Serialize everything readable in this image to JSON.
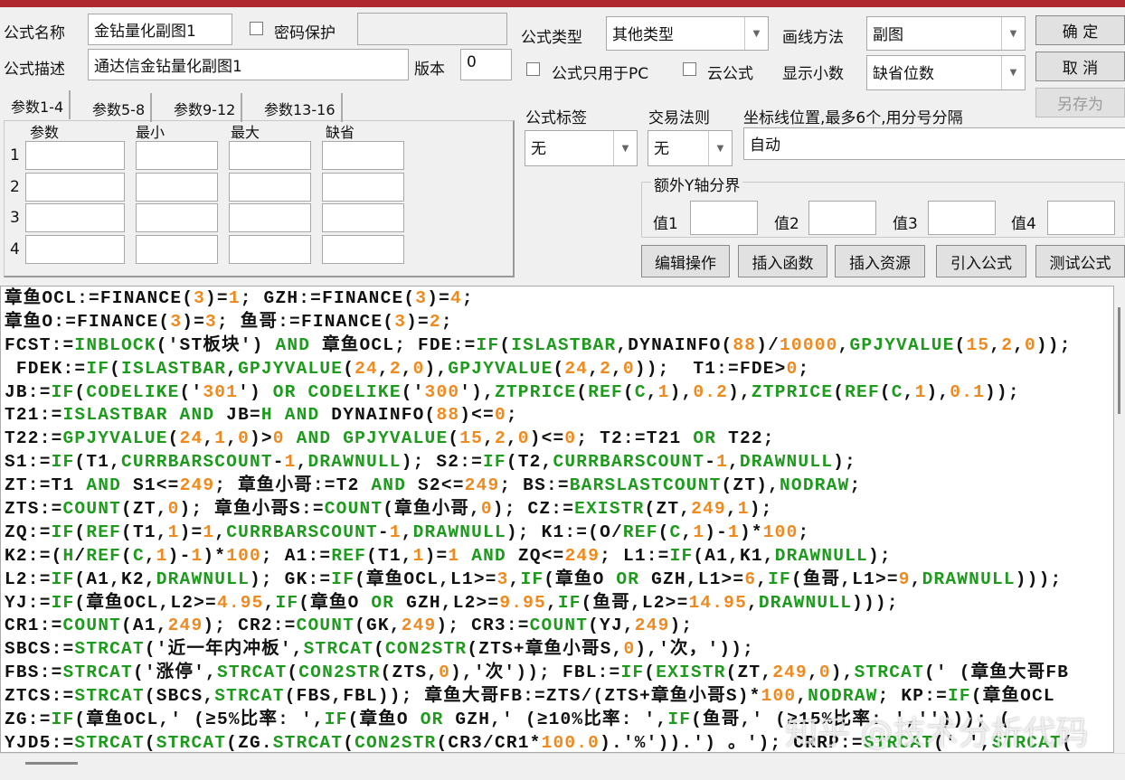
{
  "form": {
    "name_label": "公式名称",
    "name_value": "金钻量化副图1",
    "password_label": "密码保护",
    "desc_label": "公式描述",
    "desc_value": "通达信金钻量化副图1",
    "version_label": "版本",
    "version_value": "0",
    "type_label": "公式类型",
    "type_value": "其他类型",
    "draw_label": "画线方法",
    "draw_value": "副图",
    "pc_only_label": "公式只用于PC",
    "cloud_label": "云公式",
    "decimals_label": "显示小数",
    "decimals_value": "缺省位数",
    "tag_label": "公式标签",
    "tag_value": "无",
    "trade_label": "交易法则",
    "trade_value": "无",
    "axis_label": "坐标线位置,最多6个,用分号分隔",
    "axis_value": "自动",
    "extra_y_label": "额外Y轴分界",
    "values": [
      "值1",
      "值2",
      "值3",
      "值4"
    ]
  },
  "buttons": {
    "ok": "确 定",
    "cancel": "取 消",
    "save_as": "另存为",
    "edit": "编辑操作",
    "insert_func": "插入函数",
    "insert_res": "插入资源",
    "import": "引入公式",
    "test": "测试公式"
  },
  "params": {
    "tabs": [
      "参数1-4",
      "参数5-8",
      "参数9-12",
      "参数13-16"
    ],
    "headers": [
      "参数",
      "最小",
      "最大",
      "缺省"
    ],
    "rows": [
      "1",
      "2",
      "3",
      "4"
    ]
  },
  "watermark": "知乎 @技术分析代码",
  "code_lines": [
    [
      [
        "t",
        "章鱼OCL:=FINANCE("
      ],
      [
        "n",
        "3"
      ],
      [
        "t",
        ")="
      ],
      [
        "n",
        "1"
      ],
      [
        "t",
        "; GZH:=FINANCE("
      ],
      [
        "n",
        "3"
      ],
      [
        "t",
        ")="
      ],
      [
        "n",
        "4"
      ],
      [
        "t",
        ";"
      ]
    ],
    [
      [
        "t",
        "章鱼O:=FINANCE("
      ],
      [
        "n",
        "3"
      ],
      [
        "t",
        ")="
      ],
      [
        "n",
        "3"
      ],
      [
        "t",
        "; 鱼哥:=FINANCE("
      ],
      [
        "n",
        "3"
      ],
      [
        "t",
        ")="
      ],
      [
        "n",
        "2"
      ],
      [
        "t",
        ";"
      ]
    ],
    [
      [
        "t",
        "FCST:="
      ],
      [
        "f",
        "INBLOCK"
      ],
      [
        "t",
        "('ST板块') "
      ],
      [
        "f",
        "AND"
      ],
      [
        "t",
        " 章鱼OCL; FDE:="
      ],
      [
        "f",
        "IF"
      ],
      [
        "t",
        "("
      ],
      [
        "f",
        "ISLASTBAR"
      ],
      [
        "t",
        ",DYNAINFO("
      ],
      [
        "n",
        "88"
      ],
      [
        "t",
        ")/"
      ],
      [
        "n",
        "10000"
      ],
      [
        "t",
        ","
      ],
      [
        "f",
        "GPJYVALUE"
      ],
      [
        "t",
        "("
      ],
      [
        "n",
        "15"
      ],
      [
        "t",
        ","
      ],
      [
        "n",
        "2"
      ],
      [
        "t",
        ","
      ],
      [
        "n",
        "0"
      ],
      [
        "t",
        "));"
      ]
    ],
    [
      [
        "t",
        " FDEK:="
      ],
      [
        "f",
        "IF"
      ],
      [
        "t",
        "("
      ],
      [
        "f",
        "ISLASTBAR"
      ],
      [
        "t",
        ","
      ],
      [
        "f",
        "GPJYVALUE"
      ],
      [
        "t",
        "("
      ],
      [
        "n",
        "24"
      ],
      [
        "t",
        ","
      ],
      [
        "n",
        "2"
      ],
      [
        "t",
        ","
      ],
      [
        "n",
        "0"
      ],
      [
        "t",
        "),"
      ],
      [
        "f",
        "GPJYVALUE"
      ],
      [
        "t",
        "("
      ],
      [
        "n",
        "24"
      ],
      [
        "t",
        ","
      ],
      [
        "n",
        "2"
      ],
      [
        "t",
        ","
      ],
      [
        "n",
        "0"
      ],
      [
        "t",
        "));  T1:=FDE>"
      ],
      [
        "n",
        "0"
      ],
      [
        "t",
        ";"
      ]
    ],
    [
      [
        "t",
        "JB:="
      ],
      [
        "f",
        "IF"
      ],
      [
        "t",
        "("
      ],
      [
        "f",
        "CODELIKE"
      ],
      [
        "t",
        "('"
      ],
      [
        "n",
        "301"
      ],
      [
        "t",
        "') "
      ],
      [
        "f",
        "OR"
      ],
      [
        "t",
        " "
      ],
      [
        "f",
        "CODELIKE"
      ],
      [
        "t",
        "('"
      ],
      [
        "n",
        "300"
      ],
      [
        "t",
        "'),"
      ],
      [
        "f",
        "ZTPRICE"
      ],
      [
        "t",
        "("
      ],
      [
        "f",
        "REF"
      ],
      [
        "t",
        "("
      ],
      [
        "f",
        "C"
      ],
      [
        "t",
        ","
      ],
      [
        "n",
        "1"
      ],
      [
        "t",
        "),"
      ],
      [
        "n",
        "0.2"
      ],
      [
        "t",
        "),"
      ],
      [
        "f",
        "ZTPRICE"
      ],
      [
        "t",
        "("
      ],
      [
        "f",
        "REF"
      ],
      [
        "t",
        "("
      ],
      [
        "f",
        "C"
      ],
      [
        "t",
        ","
      ],
      [
        "n",
        "1"
      ],
      [
        "t",
        "),"
      ],
      [
        "n",
        "0.1"
      ],
      [
        "t",
        "));"
      ]
    ],
    [
      [
        "t",
        "T21:="
      ],
      [
        "f",
        "ISLASTBAR"
      ],
      [
        "t",
        " "
      ],
      [
        "f",
        "AND"
      ],
      [
        "t",
        " JB="
      ],
      [
        "f",
        "H"
      ],
      [
        "t",
        " "
      ],
      [
        "f",
        "AND"
      ],
      [
        "t",
        " DYNAINFO("
      ],
      [
        "n",
        "88"
      ],
      [
        "t",
        ")<="
      ],
      [
        "n",
        "0"
      ],
      [
        "t",
        ";"
      ]
    ],
    [
      [
        "t",
        "T22:="
      ],
      [
        "f",
        "GPJYVALUE"
      ],
      [
        "t",
        "("
      ],
      [
        "n",
        "24"
      ],
      [
        "t",
        ","
      ],
      [
        "n",
        "1"
      ],
      [
        "t",
        ","
      ],
      [
        "n",
        "0"
      ],
      [
        "t",
        ")>"
      ],
      [
        "n",
        "0"
      ],
      [
        "t",
        " "
      ],
      [
        "f",
        "AND"
      ],
      [
        "t",
        " "
      ],
      [
        "f",
        "GPJYVALUE"
      ],
      [
        "t",
        "("
      ],
      [
        "n",
        "15"
      ],
      [
        "t",
        ","
      ],
      [
        "n",
        "2"
      ],
      [
        "t",
        ","
      ],
      [
        "n",
        "0"
      ],
      [
        "t",
        ")<="
      ],
      [
        "n",
        "0"
      ],
      [
        "t",
        "; T2:=T21 "
      ],
      [
        "f",
        "OR"
      ],
      [
        "t",
        " T22;"
      ]
    ],
    [
      [
        "t",
        "S1:="
      ],
      [
        "f",
        "IF"
      ],
      [
        "t",
        "(T1,"
      ],
      [
        "f",
        "CURRBARSCOUNT"
      ],
      [
        "t",
        "-"
      ],
      [
        "n",
        "1"
      ],
      [
        "t",
        ","
      ],
      [
        "f",
        "DRAWNULL"
      ],
      [
        "t",
        "); S2:="
      ],
      [
        "f",
        "IF"
      ],
      [
        "t",
        "(T2,"
      ],
      [
        "f",
        "CURRBARSCOUNT"
      ],
      [
        "t",
        "-"
      ],
      [
        "n",
        "1"
      ],
      [
        "t",
        ","
      ],
      [
        "f",
        "DRAWNULL"
      ],
      [
        "t",
        ");"
      ]
    ],
    [
      [
        "t",
        "ZT:=T1 "
      ],
      [
        "f",
        "AND"
      ],
      [
        "t",
        " S1<="
      ],
      [
        "n",
        "249"
      ],
      [
        "t",
        "; 章鱼小哥:=T2 "
      ],
      [
        "f",
        "AND"
      ],
      [
        "t",
        " S2<="
      ],
      [
        "n",
        "249"
      ],
      [
        "t",
        "; BS:="
      ],
      [
        "f",
        "BARSLASTCOUNT"
      ],
      [
        "t",
        "(ZT),"
      ],
      [
        "f",
        "NODRAW"
      ],
      [
        "t",
        ";"
      ]
    ],
    [
      [
        "t",
        "ZTS:="
      ],
      [
        "f",
        "COUNT"
      ],
      [
        "t",
        "(ZT,"
      ],
      [
        "n",
        "0"
      ],
      [
        "t",
        "); 章鱼小哥S:="
      ],
      [
        "f",
        "COUNT"
      ],
      [
        "t",
        "(章鱼小哥,"
      ],
      [
        "n",
        "0"
      ],
      [
        "t",
        "); CZ:="
      ],
      [
        "f",
        "EXISTR"
      ],
      [
        "t",
        "(ZT,"
      ],
      [
        "n",
        "249"
      ],
      [
        "t",
        ","
      ],
      [
        "n",
        "1"
      ],
      [
        "t",
        ");"
      ]
    ],
    [
      [
        "t",
        "ZQ:="
      ],
      [
        "f",
        "IF"
      ],
      [
        "t",
        "("
      ],
      [
        "f",
        "REF"
      ],
      [
        "t",
        "(T1,"
      ],
      [
        "n",
        "1"
      ],
      [
        "t",
        ")="
      ],
      [
        "n",
        "1"
      ],
      [
        "t",
        ","
      ],
      [
        "f",
        "CURRBARSCOUNT"
      ],
      [
        "t",
        "-"
      ],
      [
        "n",
        "1"
      ],
      [
        "t",
        ","
      ],
      [
        "f",
        "DRAWNULL"
      ],
      [
        "t",
        "); K1:=(O/"
      ],
      [
        "f",
        "REF"
      ],
      [
        "t",
        "("
      ],
      [
        "f",
        "C"
      ],
      [
        "t",
        ","
      ],
      [
        "n",
        "1"
      ],
      [
        "t",
        ")-"
      ],
      [
        "n",
        "1"
      ],
      [
        "t",
        ")*"
      ],
      [
        "n",
        "100"
      ],
      [
        "t",
        ";"
      ]
    ],
    [
      [
        "t",
        "K2:=("
      ],
      [
        "f",
        "H"
      ],
      [
        "t",
        "/"
      ],
      [
        "f",
        "REF"
      ],
      [
        "t",
        "("
      ],
      [
        "f",
        "C"
      ],
      [
        "t",
        ","
      ],
      [
        "n",
        "1"
      ],
      [
        "t",
        ")-"
      ],
      [
        "n",
        "1"
      ],
      [
        "t",
        ")*"
      ],
      [
        "n",
        "100"
      ],
      [
        "t",
        "; A1:="
      ],
      [
        "f",
        "REF"
      ],
      [
        "t",
        "(T1,"
      ],
      [
        "n",
        "1"
      ],
      [
        "t",
        ")="
      ],
      [
        "n",
        "1"
      ],
      [
        "t",
        " "
      ],
      [
        "f",
        "AND"
      ],
      [
        "t",
        " ZQ<="
      ],
      [
        "n",
        "249"
      ],
      [
        "t",
        "; L1:="
      ],
      [
        "f",
        "IF"
      ],
      [
        "t",
        "(A1,K1,"
      ],
      [
        "f",
        "DRAWNULL"
      ],
      [
        "t",
        ");"
      ]
    ],
    [
      [
        "t",
        "L2:="
      ],
      [
        "f",
        "IF"
      ],
      [
        "t",
        "(A1,K2,"
      ],
      [
        "f",
        "DRAWNULL"
      ],
      [
        "t",
        "); GK:="
      ],
      [
        "f",
        "IF"
      ],
      [
        "t",
        "(章鱼OCL,L1>="
      ],
      [
        "n",
        "3"
      ],
      [
        "t",
        ","
      ],
      [
        "f",
        "IF"
      ],
      [
        "t",
        "(章鱼O "
      ],
      [
        "f",
        "OR"
      ],
      [
        "t",
        " GZH,L1>="
      ],
      [
        "n",
        "6"
      ],
      [
        "t",
        ","
      ],
      [
        "f",
        "IF"
      ],
      [
        "t",
        "(鱼哥,L1>="
      ],
      [
        "n",
        "9"
      ],
      [
        "t",
        ","
      ],
      [
        "f",
        "DRAWNULL"
      ],
      [
        "t",
        ")));"
      ]
    ],
    [
      [
        "t",
        "YJ:="
      ],
      [
        "f",
        "IF"
      ],
      [
        "t",
        "(章鱼OCL,L2>="
      ],
      [
        "n",
        "4.95"
      ],
      [
        "t",
        ","
      ],
      [
        "f",
        "IF"
      ],
      [
        "t",
        "(章鱼O "
      ],
      [
        "f",
        "OR"
      ],
      [
        "t",
        " GZH,L2>="
      ],
      [
        "n",
        "9.95"
      ],
      [
        "t",
        ","
      ],
      [
        "f",
        "IF"
      ],
      [
        "t",
        "(鱼哥,L2>="
      ],
      [
        "n",
        "14.95"
      ],
      [
        "t",
        ","
      ],
      [
        "f",
        "DRAWNULL"
      ],
      [
        "t",
        ")));"
      ]
    ],
    [
      [
        "t",
        "CR1:="
      ],
      [
        "f",
        "COUNT"
      ],
      [
        "t",
        "(A1,"
      ],
      [
        "n",
        "249"
      ],
      [
        "t",
        "); CR2:="
      ],
      [
        "f",
        "COUNT"
      ],
      [
        "t",
        "(GK,"
      ],
      [
        "n",
        "249"
      ],
      [
        "t",
        "); CR3:="
      ],
      [
        "f",
        "COUNT"
      ],
      [
        "t",
        "(YJ,"
      ],
      [
        "n",
        "249"
      ],
      [
        "t",
        ");"
      ]
    ],
    [
      [
        "t",
        "SBCS:="
      ],
      [
        "f",
        "STRCAT"
      ],
      [
        "t",
        "('近一年内冲板',"
      ],
      [
        "f",
        "STRCAT"
      ],
      [
        "t",
        "("
      ],
      [
        "f",
        "CON2STR"
      ],
      [
        "t",
        "(ZTS+章鱼小哥S,"
      ],
      [
        "n",
        "0"
      ],
      [
        "t",
        "),'次，'));"
      ]
    ],
    [
      [
        "t",
        "FBS:="
      ],
      [
        "f",
        "STRCAT"
      ],
      [
        "t",
        "('涨停',"
      ],
      [
        "f",
        "STRCAT"
      ],
      [
        "t",
        "("
      ],
      [
        "f",
        "CON2STR"
      ],
      [
        "t",
        "(ZTS,"
      ],
      [
        "n",
        "0"
      ],
      [
        "t",
        "),'次')); FBL:="
      ],
      [
        "f",
        "IF"
      ],
      [
        "t",
        "("
      ],
      [
        "f",
        "EXISTR"
      ],
      [
        "t",
        "(ZT,"
      ],
      [
        "n",
        "249"
      ],
      [
        "t",
        ","
      ],
      [
        "n",
        "0"
      ],
      [
        "t",
        "),"
      ],
      [
        "f",
        "STRCAT"
      ],
      [
        "t",
        "(' (章鱼大哥FB"
      ]
    ],
    [
      [
        "t",
        "ZTCS:="
      ],
      [
        "f",
        "STRCAT"
      ],
      [
        "t",
        "(SBCS,"
      ],
      [
        "f",
        "STRCAT"
      ],
      [
        "t",
        "(FBS,FBL)); 章鱼大哥FB:=ZTS/(ZTS+章鱼小哥S)*"
      ],
      [
        "n",
        "100"
      ],
      [
        "t",
        ","
      ],
      [
        "f",
        "NODRAW"
      ],
      [
        "t",
        "; KP:="
      ],
      [
        "f",
        "IF"
      ],
      [
        "t",
        "(章鱼OCL"
      ]
    ],
    [
      [
        "t",
        "ZG:="
      ],
      [
        "f",
        "IF"
      ],
      [
        "t",
        "(章鱼OCL,' (≥5%比率: ',"
      ],
      [
        "f",
        "IF"
      ],
      [
        "t",
        "(章鱼O "
      ],
      [
        "f",
        "OR"
      ],
      [
        "t",
        " GZH,' (≥10%比率: ',"
      ],
      [
        "f",
        "IF"
      ],
      [
        "t",
        "(鱼哥,' (≥15%比率: ',''))); ("
      ]
    ],
    [
      [
        "t",
        "YJD5:="
      ],
      [
        "f",
        "STRCAT"
      ],
      [
        "t",
        "("
      ],
      [
        "f",
        "STRCAT"
      ],
      [
        "t",
        "(ZG."
      ],
      [
        "f",
        "STRCAT"
      ],
      [
        "t",
        "("
      ],
      [
        "f",
        "CON2STR"
      ],
      [
        "t",
        "(CR3/CR1*"
      ],
      [
        "n",
        "100.0"
      ],
      [
        "t",
        ").'%')).') 。'); CRRP:="
      ],
      [
        "f",
        "STRCAT"
      ],
      [
        "t",
        "(' ',"
      ],
      [
        "f",
        "STRCAT"
      ],
      [
        "t",
        "("
      ]
    ]
  ]
}
